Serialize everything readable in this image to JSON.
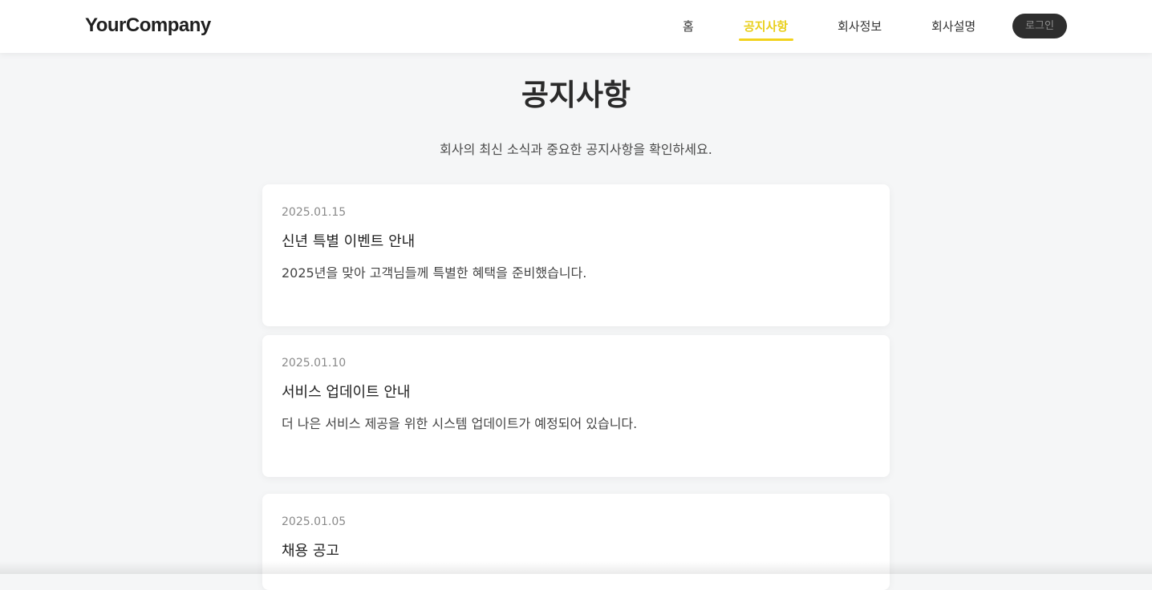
{
  "header": {
    "logo": "YourCompany",
    "nav": [
      {
        "label": "홈",
        "active": false
      },
      {
        "label": "공지사항",
        "active": true
      },
      {
        "label": "회사정보",
        "active": false
      },
      {
        "label": "회사설명",
        "active": false
      }
    ],
    "login_label": "로그인"
  },
  "main": {
    "title": "공지사항",
    "subtitle": "회사의 최신 소식과 중요한 공지사항을 확인하세요.",
    "notices": [
      {
        "date": "2025.01.15",
        "title": "신년 특별 이벤트 안내",
        "body": "2025년을 맞아 고객님들께 특별한 혜택을 준비했습니다."
      },
      {
        "date": "2025.01.10",
        "title": "서비스 업데이트 안내",
        "body": "더 나은 서비스 제공을 위한 시스템 업데이트가 예정되어 있습니다."
      },
      {
        "date": "2025.01.05",
        "title": "채용 공고",
        "body": ""
      }
    ]
  },
  "colors": {
    "accent": "#f2d21b",
    "background": "#f5f6f7",
    "login_button": "#2e2e2e"
  }
}
